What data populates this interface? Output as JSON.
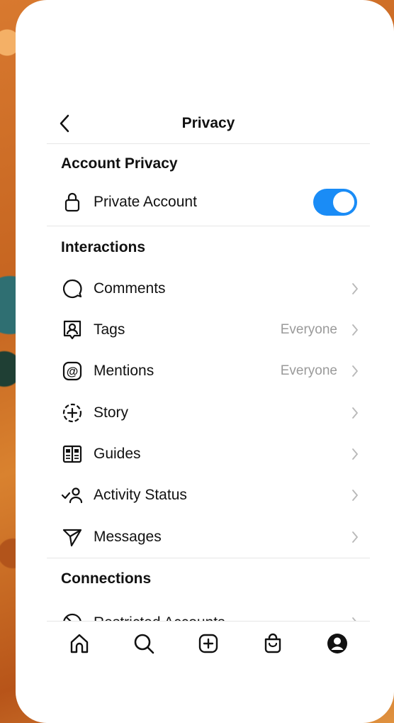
{
  "header": {
    "title": "Privacy",
    "back_icon": "chevron-left-icon"
  },
  "account_privacy": {
    "title": "Account Privacy",
    "private_account": {
      "label": "Private Account",
      "icon": "lock-icon",
      "enabled": true,
      "toggle_color": "#1a8cf6"
    }
  },
  "interactions": {
    "title": "Interactions",
    "items": [
      {
        "label": "Comments",
        "icon": "comment-bubble-icon",
        "value": ""
      },
      {
        "label": "Tags",
        "icon": "tag-person-icon",
        "value": "Everyone"
      },
      {
        "label": "Mentions",
        "icon": "at-sign-icon",
        "value": "Everyone"
      },
      {
        "label": "Story",
        "icon": "story-add-icon",
        "value": ""
      },
      {
        "label": "Guides",
        "icon": "guides-book-icon",
        "value": ""
      },
      {
        "label": "Activity Status",
        "icon": "activity-status-icon",
        "value": ""
      },
      {
        "label": "Messages",
        "icon": "paper-plane-icon",
        "value": ""
      }
    ]
  },
  "connections": {
    "title": "Connections",
    "items": [
      {
        "label": "Restricted Accounts",
        "icon": "restricted-icon"
      }
    ]
  },
  "tabbar": {
    "tabs": [
      {
        "name": "home",
        "icon": "home-icon"
      },
      {
        "name": "search",
        "icon": "search-icon"
      },
      {
        "name": "create",
        "icon": "plus-square-icon"
      },
      {
        "name": "shop",
        "icon": "shopping-bag-icon"
      },
      {
        "name": "profile",
        "icon": "profile-icon"
      }
    ]
  },
  "colors": {
    "accent": "#1a8cf6",
    "text": "#111111",
    "muted": "#9a9a9a",
    "divider": "#e6e6e6"
  }
}
